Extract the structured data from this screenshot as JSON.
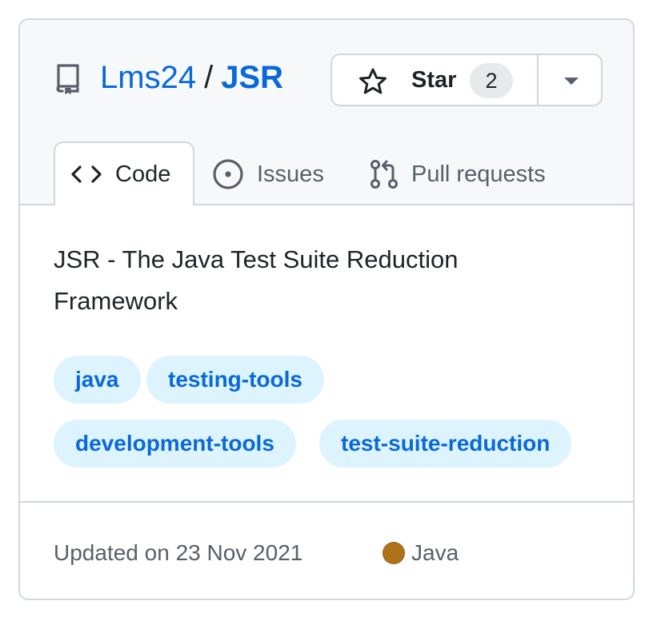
{
  "repo": {
    "owner": "Lms24",
    "separator": "/",
    "name": "JSR",
    "icon": "repo-icon"
  },
  "star": {
    "label": "Star",
    "count": "2",
    "icon": "star-icon",
    "dropdown_icon": "caret-down-icon"
  },
  "tabs": [
    {
      "label": "Code",
      "icon": "code-icon",
      "active": true
    },
    {
      "label": "Issues",
      "icon": "issue-opened-icon",
      "active": false
    },
    {
      "label": "Pull requests",
      "icon": "git-pull-request-icon",
      "active": false
    }
  ],
  "description": "JSR - The Java Test Suite Reduction Framework",
  "topics": [
    "java",
    "testing-tools",
    "development-tools",
    "test-suite-reduction"
  ],
  "footer": {
    "updated": "Updated on 23 Nov 2021",
    "language": "Java",
    "language_color": "#b07219"
  },
  "colors": {
    "link": "#0969da",
    "topic_bg": "#ddf4ff",
    "border": "#d0d7de",
    "header_bg": "#f6f8fa"
  }
}
